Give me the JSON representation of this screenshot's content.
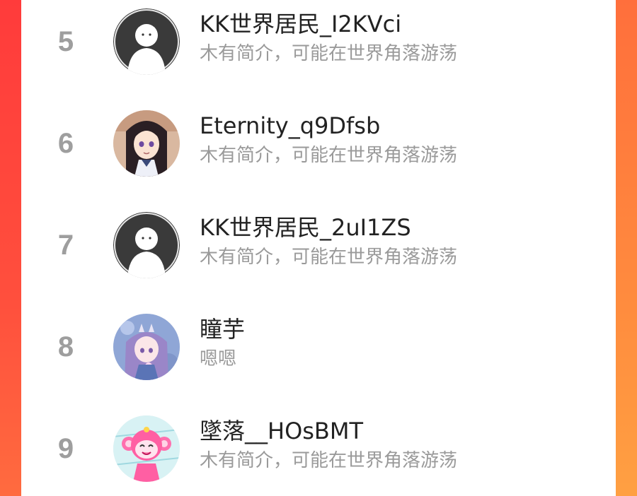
{
  "theme": {
    "rank_color": "#9e9e9e",
    "name_color": "#222222",
    "bio_color": "#9a9a9a",
    "background_gradient": [
      "#ff4a3d",
      "#ff8a3e"
    ]
  },
  "list": {
    "items": [
      {
        "rank": "5",
        "name": "KK世界居民_I2KVci",
        "bio": "木有简介，可能在世界角落游荡",
        "avatar": "default-person-avatar"
      },
      {
        "rank": "6",
        "name": "Eternity_q9Dfsb",
        "bio": "木有简介，可能在世界角落游荡",
        "avatar": "anime-girl-avatar"
      },
      {
        "rank": "7",
        "name": "KK世界居民_2uI1ZS",
        "bio": "木有简介，可能在世界角落游荡",
        "avatar": "default-person-avatar"
      },
      {
        "rank": "8",
        "name": "瞳芋",
        "bio": "嗯嗯",
        "avatar": "anime-girl-purple-avatar"
      },
      {
        "rank": "9",
        "name": "墜落__HOsBMT",
        "bio": "木有简介，可能在世界角落游荡",
        "avatar": "pink-monkey-avatar"
      }
    ]
  }
}
